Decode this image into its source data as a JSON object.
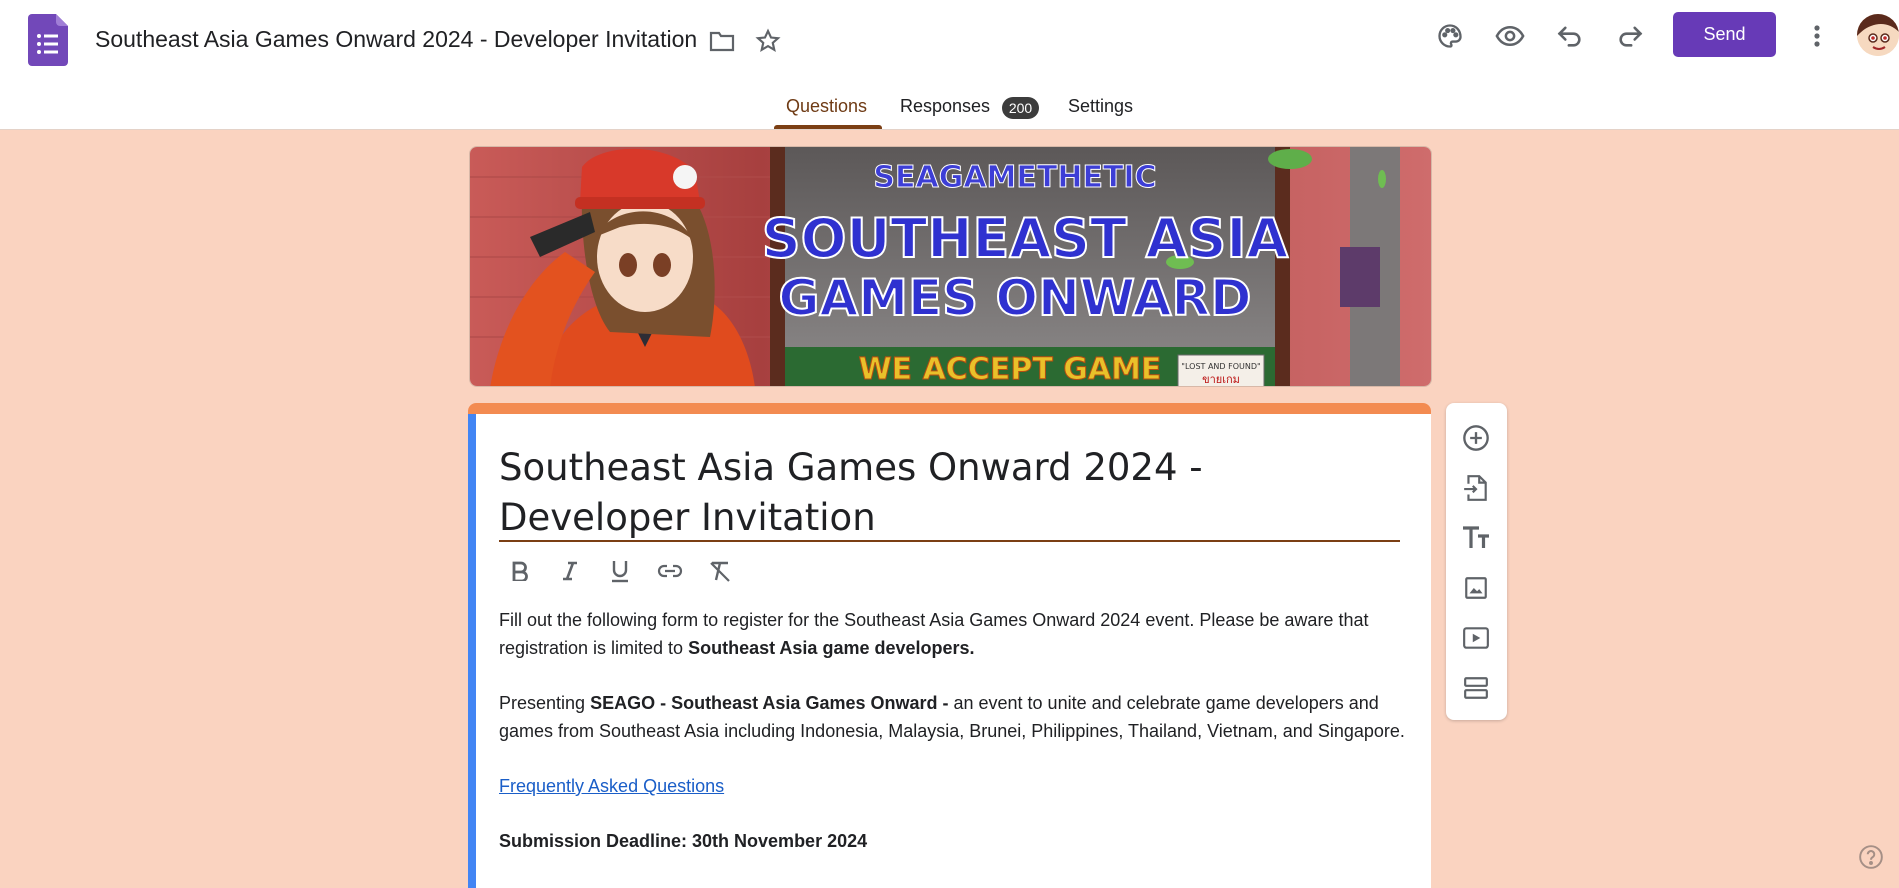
{
  "header": {
    "doc_title": "Southeast Asia Games Onward 2024 - Developer Invitation",
    "send_label": "Send"
  },
  "tabs": {
    "questions": "Questions",
    "responses": "Responses",
    "responses_count": "200",
    "settings": "Settings"
  },
  "banner": {
    "top_text": "SEAGAMETHETIC",
    "line1": "SOUTHEAST ASIA",
    "line2": "GAMES ONWARD",
    "bottom_text": "WE ACCEPT GAME",
    "sign_line1": "\"LOST AND FOUND\"",
    "sign_line2": "ขายเกม"
  },
  "form": {
    "title": "Southeast Asia Games Onward 2024 - Developer Invitation",
    "desc1_plain": "Fill out the following form to register for the Southeast Asia Games Onward 2024 event. Please be aware that registration is limited to ",
    "desc1_bold": "Southeast Asia game developers.",
    "desc2_plain1": "Presenting ",
    "desc2_bold": "SEAGO - Southeast Asia Games Onward -",
    "desc2_plain2": " an event to unite and celebrate game developers and games from Southeast Asia including Indonesia, Malaysia, Brunei, Philippines, Thailand, Vietnam, and Singapore.",
    "faq_link": "Frequently Asked Questions",
    "deadline": "Submission Deadline: 30th November 2024"
  },
  "colors": {
    "background": "#fad3c0",
    "accent": "#673ab7",
    "card_top": "#f38b51",
    "card_left": "#4285f4"
  }
}
